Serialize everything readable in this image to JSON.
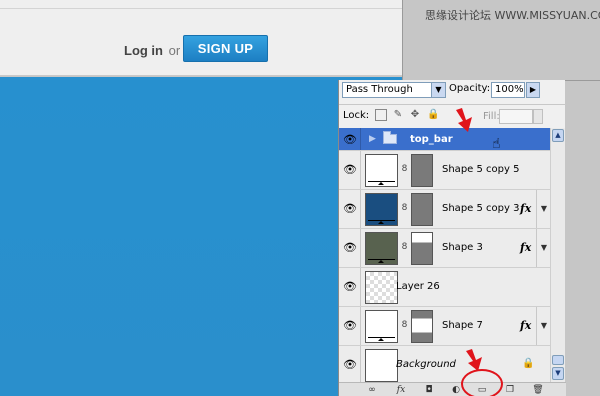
{
  "watermark": "思缘设计论坛 WWW.MISSYUAN.COM",
  "web": {
    "login_label": "Log in",
    "or_label": "or",
    "signup_label": "SIGN UP"
  },
  "layers_panel": {
    "blend_mode": "Pass Through",
    "opacity_label": "Opacity:",
    "opacity_value": "100%",
    "lock_label": "Lock:",
    "fill_label": "Fill:",
    "layers": [
      {
        "name": "top_bar",
        "type": "group",
        "selected": true
      },
      {
        "name": "Shape 5 copy 5",
        "type": "shape",
        "thumb_color": "#ffffff",
        "fx": false
      },
      {
        "name": "Shape 5 copy 3",
        "type": "shape",
        "thumb_color": "#1a4e80",
        "fx": true,
        "fx_label": "fx"
      },
      {
        "name": "Shape 3",
        "type": "shape",
        "thumb_color": "#58624f",
        "fx": true,
        "fx_label": "fx"
      },
      {
        "name": "Layer 26",
        "type": "raster",
        "fx": false
      },
      {
        "name": "Shape 7",
        "type": "shape",
        "thumb_color": "#ffffff",
        "fx": true,
        "fx_label": "fx"
      },
      {
        "name": "Background",
        "type": "background",
        "locked": true
      }
    ]
  },
  "colors": {
    "accent_blue": "#2790cf",
    "selected_layer": "#3a6fcc",
    "annotation_red": "#e0141b"
  },
  "icons": {
    "eye": "eye-icon",
    "chain": "link-icon",
    "folder": "folder-icon",
    "lock": "lock-icon"
  }
}
